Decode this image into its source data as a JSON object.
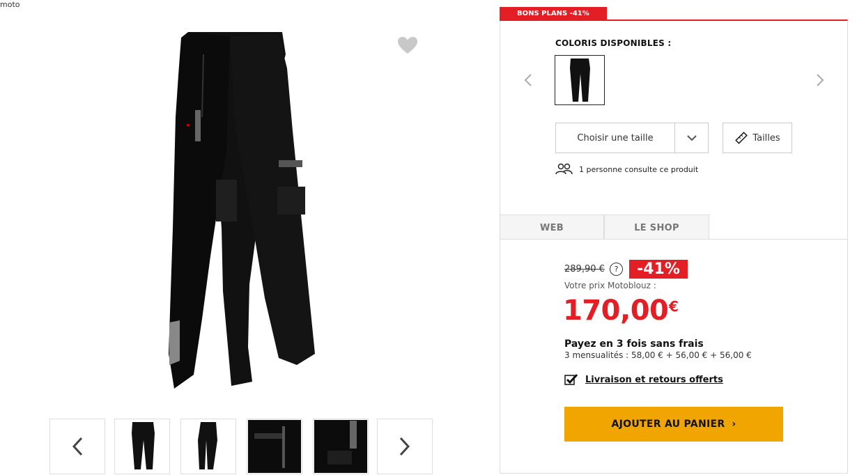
{
  "breadcrumb": {
    "last": "moto"
  },
  "promo": {
    "badge": "BONS PLANS -41%"
  },
  "colors": {
    "title": "COLORIS DISPONIBLES :"
  },
  "size": {
    "select_label": "Choisir une taille",
    "guide_label": "Tailles"
  },
  "viewers": {
    "text": "1 personne consulte ce produit"
  },
  "tabs": [
    {
      "label": "WEB"
    },
    {
      "label": "LE SHOP"
    }
  ],
  "pricing": {
    "old_price": "289,90 €",
    "help": "?",
    "discount": "-41%",
    "label": "Votre prix Motoblouz :",
    "price": "170,00",
    "currency": "€",
    "installments_title": "Payez en 3 fois sans frais",
    "installments_detail": "3 mensualités : 58,00 € + 56,00 € + 56,00 €"
  },
  "delivery": {
    "text": "Livraison et retours offerts"
  },
  "cart": {
    "label": "AJOUTER AU PANIER",
    "chevron": "›"
  },
  "icons": {
    "favorite": "heart-icon",
    "users": "users-icon",
    "ruler": "ruler-icon",
    "check": "check-icon"
  },
  "colors_palette": {
    "accent": "#e31e24",
    "cta": "#f0a500"
  }
}
